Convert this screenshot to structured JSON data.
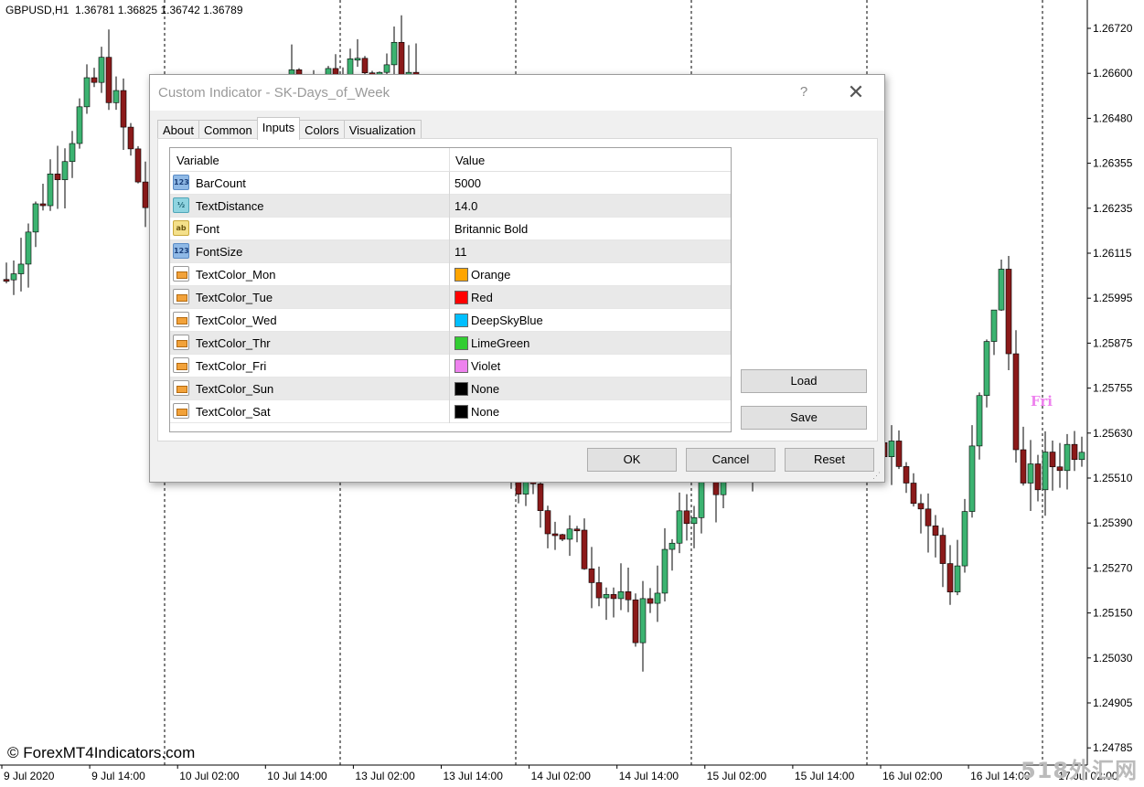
{
  "chart": {
    "symbol_line": "GBPUSD,H1  1.36781 1.36825 1.36742 1.36789",
    "price_labels": [
      "1.26720",
      "1.26600",
      "1.26480",
      "1.26355",
      "1.26235",
      "1.26115",
      "1.25995",
      "1.25875",
      "1.25755",
      "1.25630",
      "1.25510",
      "1.25390",
      "1.25270",
      "1.25150",
      "1.25030",
      "1.24905",
      "1.24785"
    ],
    "time_labels": [
      "9 Jul 2020",
      "9 Jul 14:00",
      "10 Jul 02:00",
      "10 Jul 14:00",
      "13 Jul 02:00",
      "13 Jul 14:00",
      "14 Jul 02:00",
      "14 Jul 14:00",
      "15 Jul 02:00",
      "15 Jul 14:00",
      "16 Jul 02:00",
      "16 Jul 14:00",
      "17 Jul 02:00"
    ],
    "day_label": "Fri",
    "watermark": "© ForexMT4Indicators.com",
    "corner_mark": "518外汇网",
    "colors": {
      "bull": "#3cb371",
      "bear": "#8b1a1a",
      "wick": "#000000",
      "day_text": "#ee82ee"
    }
  },
  "dialog": {
    "title": "Custom Indicator - SK-Days_of_Week",
    "help_label": "?",
    "close_label": "✕",
    "tabs": [
      {
        "label": "About"
      },
      {
        "label": "Common"
      },
      {
        "label": "Inputs"
      },
      {
        "label": "Colors"
      },
      {
        "label": "Visualization"
      }
    ],
    "active_tab": "Inputs",
    "grid_headers": {
      "variable": "Variable",
      "value": "Value"
    },
    "rows": [
      {
        "type": "int",
        "icon_text": "123",
        "name": "BarCount",
        "value": "5000"
      },
      {
        "type": "dbl",
        "icon_text": "½",
        "name": "TextDistance",
        "value": "14.0"
      },
      {
        "type": "str",
        "icon_text": "ab",
        "name": "Font",
        "value": "Britannic Bold"
      },
      {
        "type": "int",
        "icon_text": "123",
        "name": "FontSize",
        "value": "11"
      },
      {
        "type": "clr",
        "icon_text": "",
        "name": "TextColor_Mon",
        "value": "Orange",
        "swatch": "#ffa500"
      },
      {
        "type": "clr",
        "icon_text": "",
        "name": "TextColor_Tue",
        "value": "Red",
        "swatch": "#ff0000"
      },
      {
        "type": "clr",
        "icon_text": "",
        "name": "TextColor_Wed",
        "value": "DeepSkyBlue",
        "swatch": "#00bfff"
      },
      {
        "type": "clr",
        "icon_text": "",
        "name": "TextColor_Thr",
        "value": "LimeGreen",
        "swatch": "#32cd32"
      },
      {
        "type": "clr",
        "icon_text": "",
        "name": "TextColor_Fri",
        "value": "Violet",
        "swatch": "#ee82ee"
      },
      {
        "type": "clr",
        "icon_text": "",
        "name": "TextColor_Sun",
        "value": "None",
        "swatch": "#000000"
      },
      {
        "type": "clr",
        "icon_text": "",
        "name": "TextColor_Sat",
        "value": "None",
        "swatch": "#000000"
      }
    ],
    "buttons": {
      "load": "Load",
      "save": "Save",
      "ok": "OK",
      "cancel": "Cancel",
      "reset": "Reset"
    }
  }
}
